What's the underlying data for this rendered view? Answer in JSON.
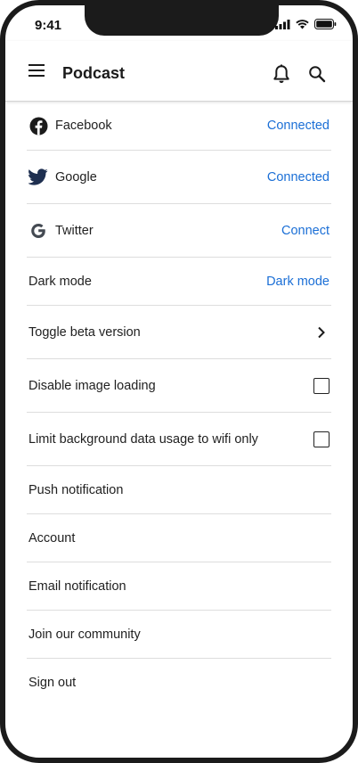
{
  "status_bar": {
    "time": "9:41"
  },
  "app_bar": {
    "title": "Podcast"
  },
  "settings": {
    "facebook": {
      "label": "Facebook",
      "action": "Connected"
    },
    "google": {
      "label": "Google",
      "action": "Connected"
    },
    "twitter": {
      "label": "Twitter",
      "action": "Connect"
    },
    "dark_mode": {
      "label": "Dark mode",
      "action": "Dark mode"
    },
    "beta": {
      "label": "Toggle beta version"
    },
    "disable_images": {
      "label": "Disable image loading",
      "checked": false
    },
    "limit_data": {
      "label": "Limit background data usage to wifi only",
      "checked": false
    },
    "push": {
      "label": "Push notification"
    },
    "account": {
      "label": "Account"
    },
    "email": {
      "label": "Email notification"
    },
    "community": {
      "label": "Join our community"
    },
    "sign_out": {
      "label": "Sign out"
    }
  },
  "colors": {
    "accent": "#1b6fd6",
    "frame": "#1b1b1b",
    "divider": "#dddddd"
  },
  "icons": [
    "menu-icon",
    "bell-icon",
    "search-icon",
    "facebook-icon",
    "twitter-bird-icon",
    "google-g-icon",
    "chevron-right-icon"
  ]
}
